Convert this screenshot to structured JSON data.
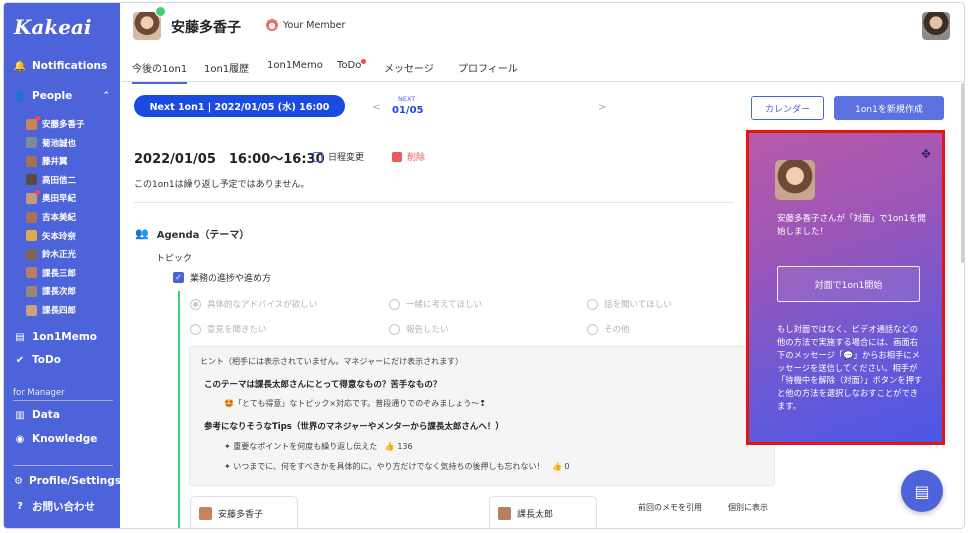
{
  "app": {
    "logo": "Kakeai"
  },
  "sidebar": {
    "notifications": "Notifications",
    "people": "People",
    "members": [
      {
        "name": "安藤多香子",
        "color": "#c7845a",
        "dot": true
      },
      {
        "name": "菊池誠也",
        "color": "#7e8a99",
        "dot": false
      },
      {
        "name": "藤井翼",
        "color": "#a3734f",
        "dot": false
      },
      {
        "name": "高田信二",
        "color": "#5a4a3f",
        "dot": false
      },
      {
        "name": "奥田早紀",
        "color": "#c79b7a",
        "dot": true
      },
      {
        "name": "吉本美紀",
        "color": "#a77258",
        "dot": false
      },
      {
        "name": "矢本玲奈",
        "color": "#e0a94e",
        "dot": false
      },
      {
        "name": "鈴木正光",
        "color": "#7d6455",
        "dot": false
      },
      {
        "name": "課長三郎",
        "color": "#b77f62",
        "dot": false
      },
      {
        "name": "課長次郎",
        "color": "#9b8776",
        "dot": false
      },
      {
        "name": "課長四郎",
        "color": "#c8a27f",
        "dot": false
      }
    ],
    "memo": "1on1Memo",
    "todo": "ToDo",
    "for_manager": "for Manager",
    "data": "Data",
    "knowledge": "Knowledge",
    "profile": "Profile/Settings",
    "contact": "お問い合わせ"
  },
  "header": {
    "name": "安藤多香子",
    "badge": "Your Member"
  },
  "tabs": [
    "今後の1on1",
    "1on1履歴",
    "1on1Memo",
    "ToDo",
    "メッセージ",
    "プロフィール"
  ],
  "next": {
    "pill": "Next 1on1 | 2022/01/05 (水) 16:00",
    "pager_tag": "NEXT",
    "pager_date": "01/05",
    "prev": "<",
    "next": ">",
    "calendar": "カレンダー",
    "new": "1on1を新規作成"
  },
  "meeting": {
    "datetime": "2022/01/05　16:00〜16:30",
    "reschedule": "日程変更",
    "delete": "削除",
    "note": "この1on1は繰り返し予定ではありません。"
  },
  "agenda": {
    "title": "Agenda（テーマ）",
    "topic_label": "トピック",
    "checked_item": "業務の進捗や進め方",
    "options": [
      "具体的なアドバイスが欲しい",
      "一緒に考えてほしい",
      "話を聞いてほしい",
      "意見を聞きたい",
      "報告したい",
      "その他"
    ]
  },
  "hint": {
    "header": "ヒント（相手には表示されていません。マネジャーにだけ表示されます）",
    "q1": "このテーマは課長太郎さんにとって得意なもの？苦手なもの？",
    "q1_answer": "🤩「とても得意」なトピック×対応です。普段通りでのぞみましょう〜❢",
    "tips_title": "参考になりそうなTips（世界のマネジャーやメンターから課長太郎さんへ！）",
    "tip1": "重要なポイントを何度も繰り返し伝えた",
    "tip1_count": "136",
    "tip2": "いつまでに、何をすべきかを具体的に。やり方だけでなく気持ちの後押しも忘れない！",
    "tip2_count": "0"
  },
  "panels": {
    "left_name": "安藤多香子",
    "right_name": "課長太郎",
    "quote_prev": "前回のメモを引用",
    "show_each": "個別に表示"
  },
  "card": {
    "message": "安藤多香子さんが「対面」で1on1を開始しました！",
    "button": "対面で1on1開始",
    "desc": "もし対面ではなく、ビデオ通話などの他の方法で実施する場合には、画面右下のメッセージ「💬」からお相手にメッセージを送信してください。相手が「待機中を解除（対面）」ボタンを押すと他の方法を選択しなおすことができます。"
  },
  "colors": {
    "primary": "#4d63d9",
    "pill": "#1b4ae0",
    "online": "#3ccf73",
    "alert": "#e81414"
  }
}
